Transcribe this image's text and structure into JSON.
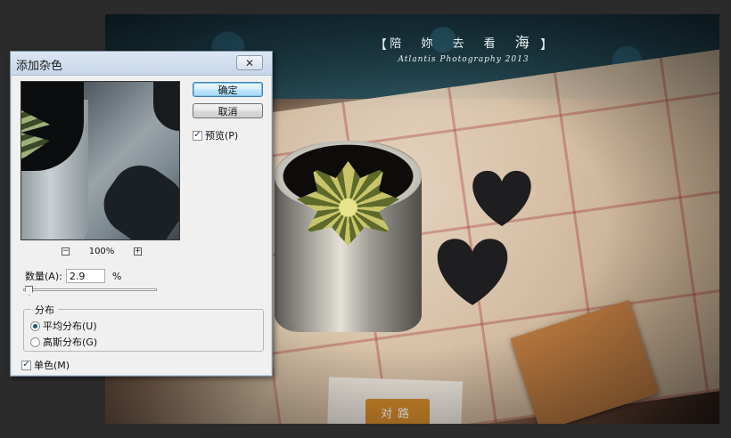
{
  "photo": {
    "watermark_title_a": "陪 妳 去 看 ",
    "watermark_title_b": "海",
    "watermark_subtitle": "Atlantis Photography 2013",
    "bracket_left": "【",
    "bracket_right": "】",
    "card_sign": "对路"
  },
  "dialog": {
    "title": "添加杂色",
    "close_icon": "✕",
    "ok_label": "确定",
    "cancel_label": "取消",
    "preview_check_mark": "✓",
    "preview_label": "预览(P)",
    "zoom_out": "−",
    "zoom_level": "100%",
    "zoom_in": "+",
    "amount_label": "数量(A):",
    "amount_value": "2.9",
    "amount_unit": "%",
    "amount_slider_fraction": 0.01,
    "distribution_legend": "分布",
    "uniform_label": "平均分布(U)",
    "gaussian_label": "高斯分布(G)",
    "selected_distribution": "uniform",
    "mono_check_mark": "✓",
    "mono_label": "单色(M)"
  }
}
